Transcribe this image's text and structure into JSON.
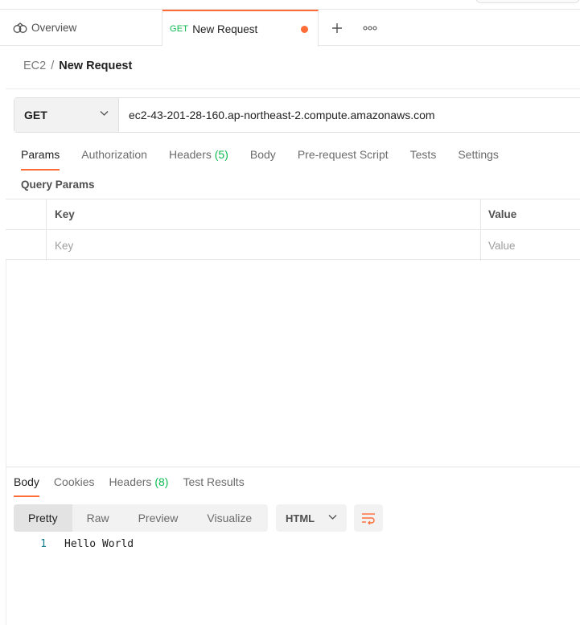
{
  "tabs": {
    "overview_label": "Overview",
    "active": {
      "method": "GET",
      "title": "New Request"
    }
  },
  "breadcrumb": {
    "parent": "EC2",
    "separator": "/",
    "current": "New Request"
  },
  "request": {
    "method": "GET",
    "url": "ec2-43-201-28-160.ap-northeast-2.compute.amazonaws.com"
  },
  "request_tabs": {
    "params": "Params",
    "authorization": "Authorization",
    "headers": "Headers",
    "headers_count": "(5)",
    "body": "Body",
    "prerequest": "Pre-request Script",
    "tests": "Tests",
    "settings": "Settings"
  },
  "query_params": {
    "title": "Query Params",
    "key_header": "Key",
    "value_header": "Value",
    "key_placeholder": "Key",
    "value_placeholder": "Value"
  },
  "response": {
    "tabs": {
      "body": "Body",
      "cookies": "Cookies",
      "headers": "Headers",
      "headers_count": "(8)",
      "test_results": "Test Results"
    },
    "view_modes": [
      "Pretty",
      "Raw",
      "Preview",
      "Visualize"
    ],
    "format": "HTML",
    "lines": [
      {
        "number": "1",
        "text": "Hello World"
      }
    ]
  },
  "colors": {
    "accent": "#ff6c37",
    "get_green": "#0cbb52"
  }
}
